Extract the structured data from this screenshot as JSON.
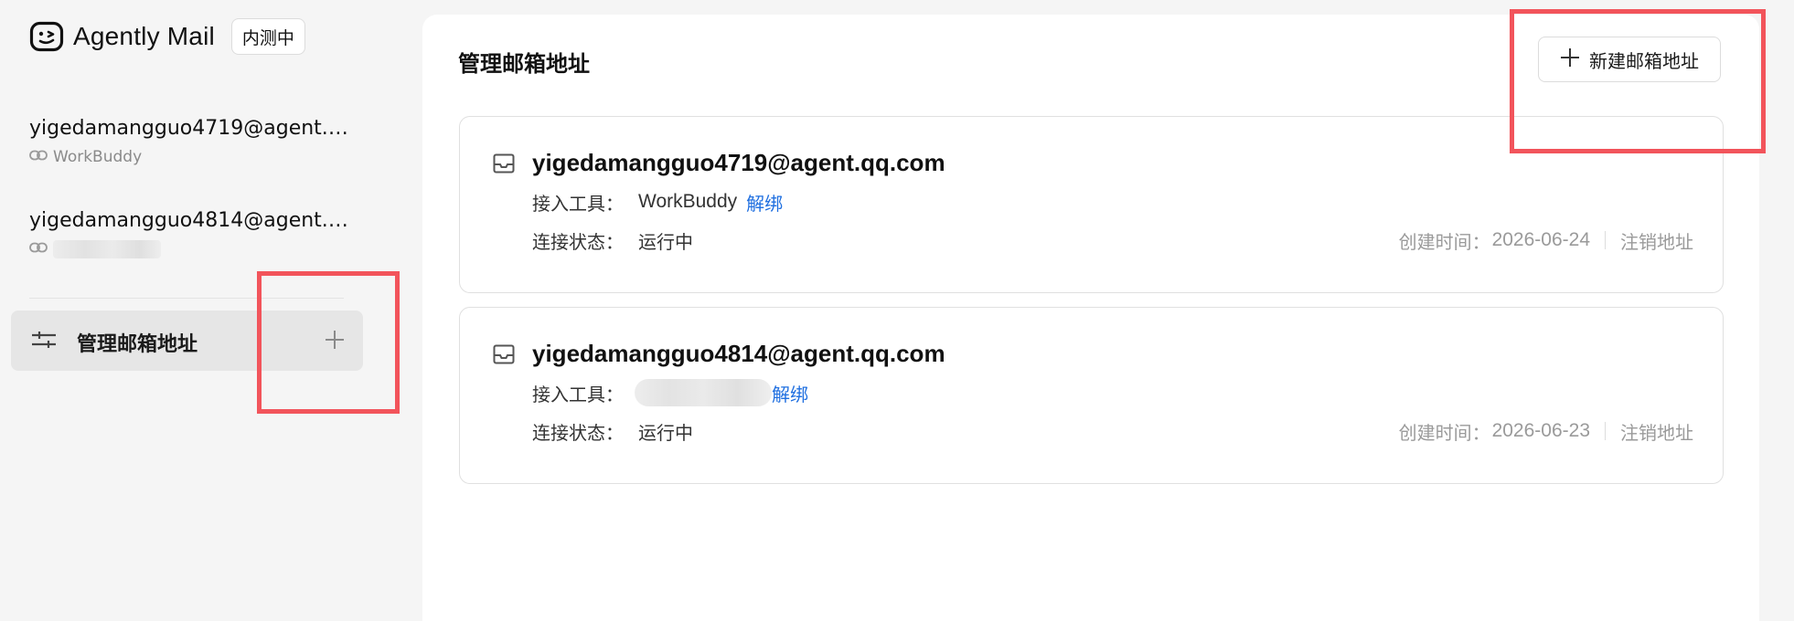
{
  "brand": {
    "name": "Agently Mail",
    "badge": "内测中"
  },
  "sidebar": {
    "mailboxes": [
      {
        "address": "yigedamangguo4719@agent.q...",
        "tool": "WorkBuddy"
      },
      {
        "address": "yigedamangguo4814@agent.q...",
        "tool": ""
      }
    ],
    "manage_label": "管理邮箱地址"
  },
  "main": {
    "title": "管理邮箱地址",
    "new_button": "新建邮箱地址",
    "cards": [
      {
        "address": "yigedamangguo4719@agent.qq.com",
        "tool_label": "接入工具：",
        "tool_value": "WorkBuddy",
        "unbind": "解绑",
        "status_label": "连接状态：",
        "status_value": "运行中",
        "created_label": "创建时间：",
        "created_date": "2026-06-24",
        "revoke": "注销地址"
      },
      {
        "address": "yigedamangguo4814@agent.qq.com",
        "tool_label": "接入工具：",
        "tool_value": "",
        "unbind": "解绑",
        "status_label": "连接状态：",
        "status_value": "运行中",
        "created_label": "创建时间：",
        "created_date": "2026-06-23",
        "revoke": "注销地址"
      }
    ]
  },
  "colors": {
    "accent_link": "#1f6fe0",
    "highlight_box": "#f2545b",
    "sidebar_bg": "#f5f5f5",
    "active_item_bg": "#e6e6e6"
  },
  "icons": {
    "brand": "smiley-logo-icon",
    "tool": "link-icon",
    "manage": "sliders-icon",
    "add": "plus-icon",
    "mailbox": "inbox-icon"
  }
}
